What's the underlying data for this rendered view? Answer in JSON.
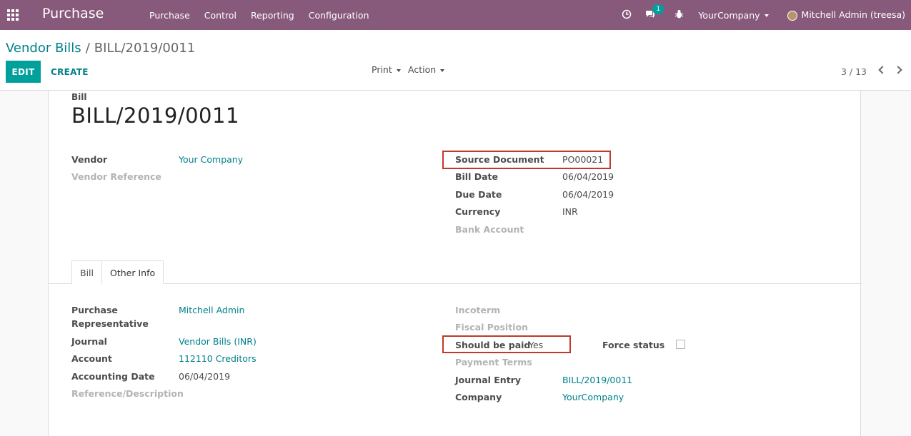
{
  "navbar": {
    "app_title": "Purchase",
    "menu": [
      "Purchase",
      "Control",
      "Reporting",
      "Configuration"
    ],
    "messages_count": "1",
    "company": "YourCompany",
    "user": "Mitchell Admin (treesa)"
  },
  "breadcrumb": {
    "parent": "Vendor Bills",
    "separator": "/",
    "current": "BILL/2019/0011"
  },
  "control": {
    "edit_label": "EDIT",
    "create_label": "CREATE",
    "print_label": "Print",
    "action_label": "Action",
    "pager": "3 / 13"
  },
  "form": {
    "doc_type": "Bill",
    "doc_name": "BILL/2019/0011",
    "vendor_label": "Vendor",
    "vendor_value": "Your Company",
    "vendor_ref_label": "Vendor Reference",
    "source_doc_label": "Source Document",
    "source_doc_value": "PO00021",
    "bill_date_label": "Bill Date",
    "bill_date_value": "06/04/2019",
    "due_date_label": "Due Date",
    "due_date_value": "06/04/2019",
    "currency_label": "Currency",
    "currency_value": "INR",
    "bank_account_label": "Bank Account"
  },
  "tabs": {
    "bill": "Bill",
    "other_info": "Other Info"
  },
  "other_info": {
    "purchase_rep_label_1": "Purchase",
    "purchase_rep_label_2": "Representative",
    "purchase_rep_value": "Mitchell Admin",
    "journal_label": "Journal",
    "journal_value": "Vendor Bills (INR)",
    "account_label": "Account",
    "account_value": "112110 Creditors",
    "accounting_date_label": "Accounting Date",
    "accounting_date_value": "06/04/2019",
    "reference_label": "Reference/Description",
    "incoterm_label": "Incoterm",
    "fiscal_position_label": "Fiscal Position",
    "should_be_paid_label": "Should be paid",
    "should_be_paid_value": "Yes",
    "force_status_label": "Force status",
    "payment_terms_label": "Payment Terms",
    "journal_entry_label": "Journal Entry",
    "journal_entry_value": "BILL/2019/0011",
    "company_label": "Company",
    "company_value": "YourCompany"
  },
  "colors": {
    "navbar": "#875a7b",
    "primary": "#00a09d",
    "link": "#00808a",
    "highlight": "#c0392b"
  }
}
